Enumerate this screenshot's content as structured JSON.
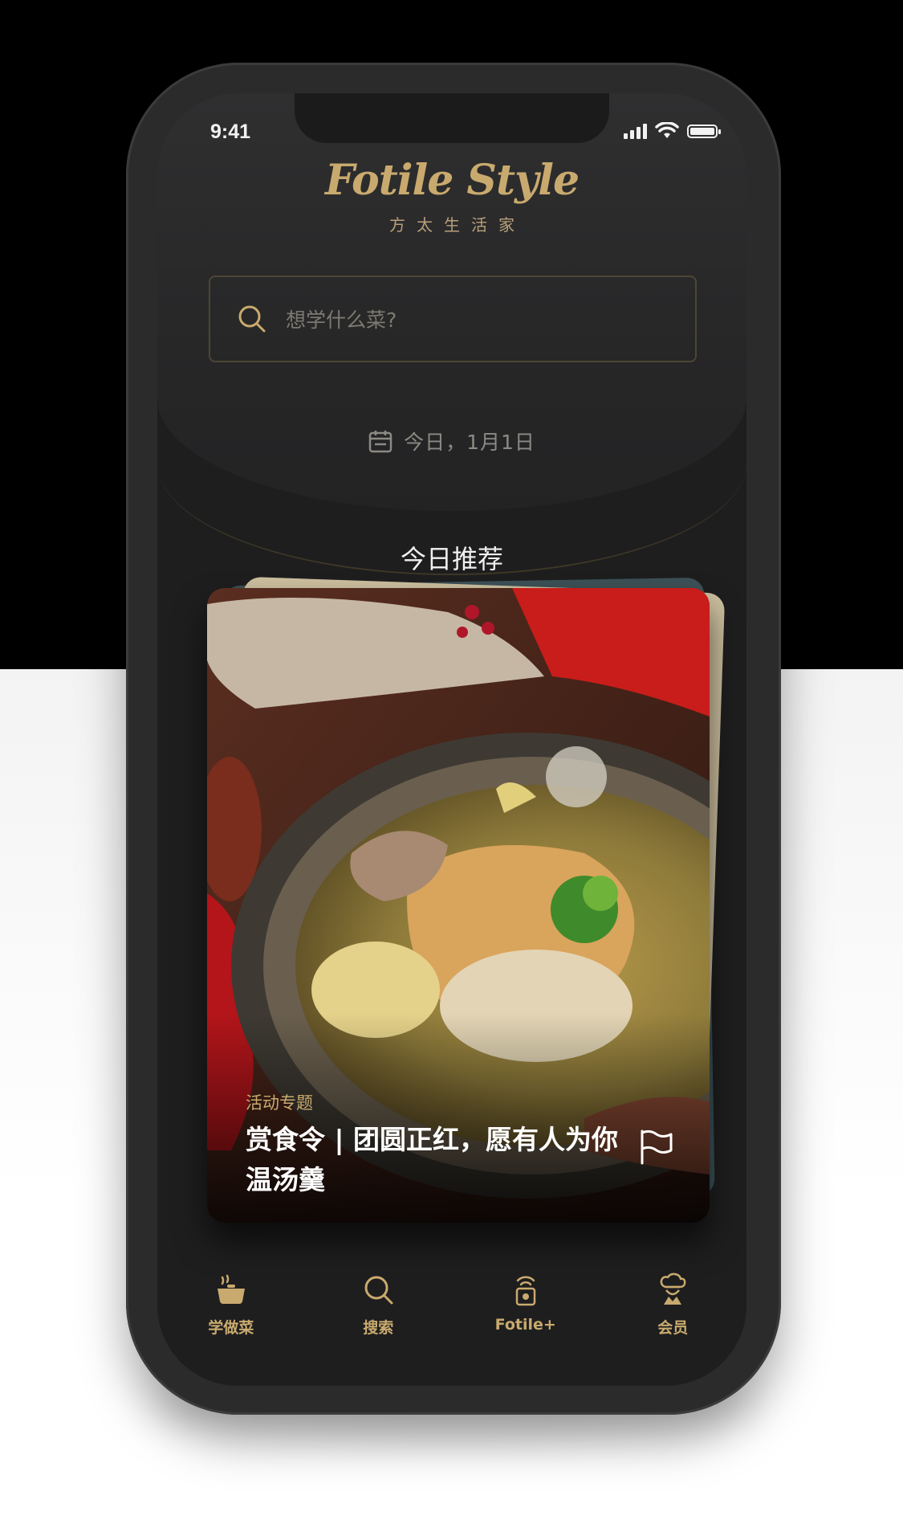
{
  "status_bar": {
    "time": "9:41"
  },
  "brand": {
    "logo": "Fotile Style",
    "subtitle": "方太生活家"
  },
  "search": {
    "placeholder": "想学什么菜?"
  },
  "date": {
    "label": "今日，1月1日"
  },
  "section": {
    "title": "今日推荐"
  },
  "card": {
    "tag": "活动专题",
    "title": "赏食令 | 团圆正红，愿有人为你温汤羹"
  },
  "tabbar": {
    "items": [
      {
        "label": "学做菜",
        "icon": "cooking-pot-icon"
      },
      {
        "label": "搜索",
        "icon": "search-icon"
      },
      {
        "label": "Fotile+",
        "icon": "smart-device-icon"
      },
      {
        "label": "会员",
        "icon": "chef-hat-icon"
      }
    ]
  },
  "colors": {
    "accent": "#c9aa6e",
    "screen": "#1e1e1f",
    "page_top": "#000000"
  }
}
